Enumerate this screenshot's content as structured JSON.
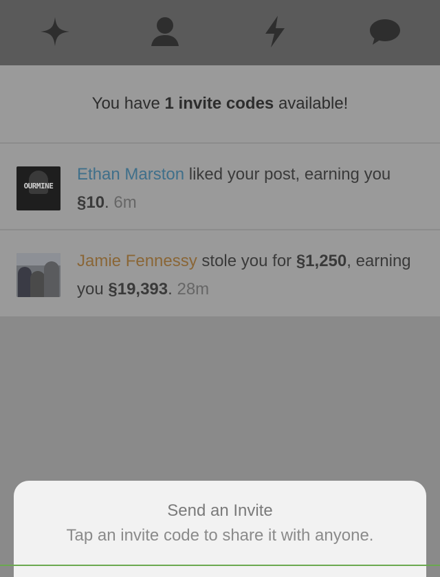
{
  "tabs": [
    {
      "icon": "sparkle-icon"
    },
    {
      "icon": "person-icon"
    },
    {
      "icon": "lightning-icon"
    },
    {
      "icon": "chat-bubble-icon"
    }
  ],
  "invite_banner": {
    "prefix": "You have ",
    "count": "1 invite codes",
    "suffix": " available!"
  },
  "notifications": [
    {
      "avatar_text": "OURMINE",
      "name": "Ethan Marston",
      "text1": " liked your post, earning you ",
      "amount1": "§10",
      "text2": ". ",
      "time": "6m"
    },
    {
      "name": "Jamie Fennessy",
      "text1": " stole you for ",
      "amount1": "§1,250",
      "text2": ", earning you ",
      "amount2": "§19,393",
      "text3": ". ",
      "time": "28m"
    }
  ],
  "sheet": {
    "title": "Send an Invite",
    "subtitle": "Tap an invite code to share it with anyone."
  },
  "colors": {
    "name_blue": "#3f6f8a",
    "name_orange": "#8a6636",
    "topbar": "#5a5a5a"
  }
}
